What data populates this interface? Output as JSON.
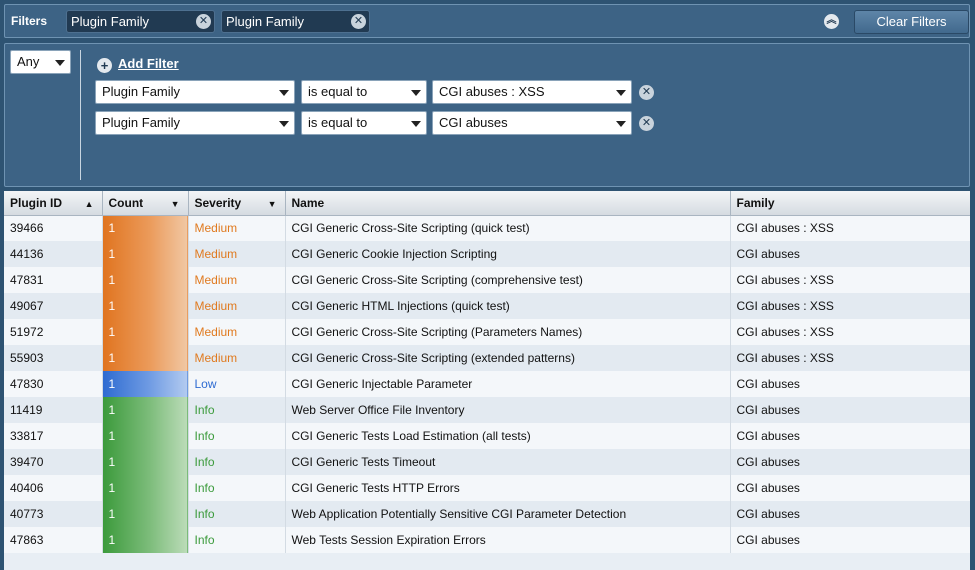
{
  "filters_bar": {
    "label": "Filters",
    "chips": [
      "Plugin Family",
      "Plugin Family"
    ],
    "clear_label": "Clear Filters"
  },
  "filter_panel": {
    "match": "Any",
    "add_filter_label": "Add Filter",
    "rules": [
      {
        "field": "Plugin Family",
        "operator": "is equal to",
        "value": "CGI abuses : XSS"
      },
      {
        "field": "Plugin Family",
        "operator": "is equal to",
        "value": "CGI abuses"
      }
    ]
  },
  "table": {
    "columns": [
      "Plugin ID",
      "Count",
      "Severity",
      "Name",
      "Family"
    ],
    "rows": [
      {
        "id": "39466",
        "count": "1",
        "severity": "Medium",
        "name": "CGI Generic Cross-Site Scripting (quick test)",
        "family": "CGI abuses : XSS"
      },
      {
        "id": "44136",
        "count": "1",
        "severity": "Medium",
        "name": "CGI Generic Cookie Injection Scripting",
        "family": "CGI abuses"
      },
      {
        "id": "47831",
        "count": "1",
        "severity": "Medium",
        "name": "CGI Generic Cross-Site Scripting (comprehensive test)",
        "family": "CGI abuses : XSS"
      },
      {
        "id": "49067",
        "count": "1",
        "severity": "Medium",
        "name": "CGI Generic HTML Injections (quick test)",
        "family": "CGI abuses : XSS"
      },
      {
        "id": "51972",
        "count": "1",
        "severity": "Medium",
        "name": "CGI Generic Cross-Site Scripting (Parameters Names)",
        "family": "CGI abuses : XSS"
      },
      {
        "id": "55903",
        "count": "1",
        "severity": "Medium",
        "name": "CGI Generic Cross-Site Scripting (extended patterns)",
        "family": "CGI abuses : XSS"
      },
      {
        "id": "47830",
        "count": "1",
        "severity": "Low",
        "name": "CGI Generic Injectable Parameter",
        "family": "CGI abuses"
      },
      {
        "id": "11419",
        "count": "1",
        "severity": "Info",
        "name": "Web Server Office File Inventory",
        "family": "CGI abuses"
      },
      {
        "id": "33817",
        "count": "1",
        "severity": "Info",
        "name": "CGI Generic Tests Load Estimation (all tests)",
        "family": "CGI abuses"
      },
      {
        "id": "39470",
        "count": "1",
        "severity": "Info",
        "name": "CGI Generic Tests Timeout",
        "family": "CGI abuses"
      },
      {
        "id": "40406",
        "count": "1",
        "severity": "Info",
        "name": "CGI Generic Tests HTTP Errors",
        "family": "CGI abuses"
      },
      {
        "id": "40773",
        "count": "1",
        "severity": "Info",
        "name": "Web Application Potentially Sensitive CGI Parameter Detection",
        "family": "CGI abuses"
      },
      {
        "id": "47863",
        "count": "1",
        "severity": "Info",
        "name": "Web Tests Session Expiration Errors",
        "family": "CGI abuses"
      }
    ]
  },
  "colors": {
    "medium": "#e07a1f",
    "low": "#2e6bd1",
    "info": "#3a9a3a"
  }
}
